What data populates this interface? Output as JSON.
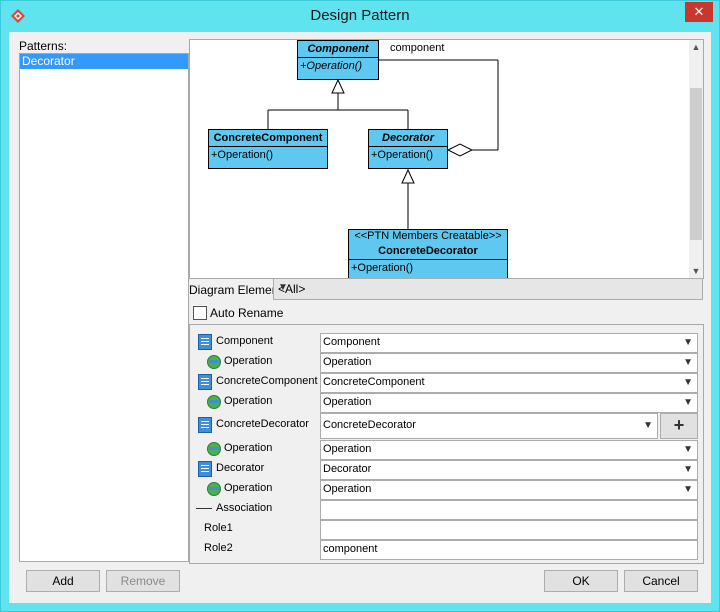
{
  "window": {
    "title": "Design Pattern",
    "close_glyph": "✕"
  },
  "patterns": {
    "label": "Patterns:",
    "items": [
      "Decorator"
    ]
  },
  "diagram": {
    "component": {
      "name": "Component",
      "op": "+Operation()"
    },
    "concrete_component": {
      "name": "ConcreteComponent",
      "op": "+Operation()"
    },
    "decorator": {
      "name": "Decorator",
      "op": "+Operation()"
    },
    "concrete_decorator": {
      "stereotype": "<<PTN Members Creatable>>",
      "name": "ConcreteDecorator",
      "op": "+Operation()"
    },
    "assoc_label": "component"
  },
  "diagram_element": {
    "label": "Diagram Element",
    "value": "<All>"
  },
  "auto_rename": {
    "label": "Auto Rename",
    "checked": false
  },
  "members": {
    "component": {
      "label": "Component",
      "value": "Component"
    },
    "component_op": {
      "label": "Operation",
      "value": "Operation"
    },
    "concrete_component": {
      "label": "ConcreteComponent",
      "value": "ConcreteComponent"
    },
    "concrete_component_op": {
      "label": "Operation",
      "value": "Operation"
    },
    "concrete_decorator": {
      "label": "ConcreteDecorator",
      "value": "ConcreteDecorator"
    },
    "concrete_decorator_op": {
      "label": "Operation",
      "value": "Operation"
    },
    "decorator": {
      "label": "Decorator",
      "value": "Decorator"
    },
    "decorator_op": {
      "label": "Operation",
      "value": "Operation"
    },
    "association": {
      "label": "Association",
      "value": ""
    },
    "role1": {
      "label": "Role1",
      "value": ""
    },
    "role2": {
      "label": "Role2",
      "value": "component"
    }
  },
  "buttons": {
    "add": "Add",
    "remove": "Remove",
    "ok": "OK",
    "cancel": "Cancel",
    "plus": "+"
  },
  "colors": {
    "title_bar": "#5fe3ef",
    "uml_fill": "#5ec8f0",
    "selection": "#3399ff",
    "close": "#c7372d"
  },
  "icons": [
    "app-icon",
    "close-icon",
    "class-icon",
    "operation-icon",
    "association-icon",
    "chevron-down-icon",
    "plus-icon",
    "scroll-up-icon",
    "scroll-down-icon"
  ]
}
